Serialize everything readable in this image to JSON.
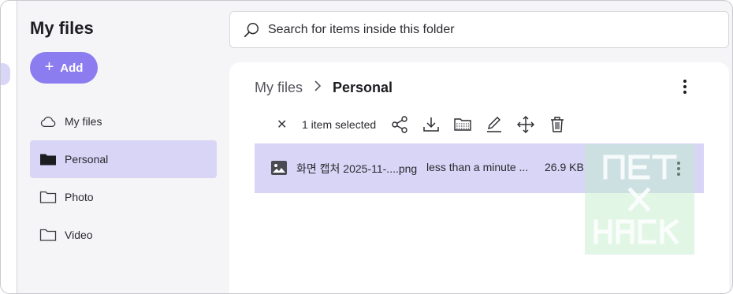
{
  "sidebar": {
    "title": "My files",
    "add_label": "Add",
    "items": [
      {
        "label": "My files",
        "icon": "cloud-icon"
      },
      {
        "label": "Personal",
        "icon": "folder-filled-icon",
        "active": true
      },
      {
        "label": "Photo",
        "icon": "folder-icon"
      },
      {
        "label": "Video",
        "icon": "folder-icon"
      }
    ]
  },
  "search": {
    "placeholder": "Search for items inside this folder"
  },
  "breadcrumb": {
    "root": "My files",
    "separator": "›",
    "current": "Personal"
  },
  "toolbar": {
    "selected_label": "1 item selected",
    "icons": [
      "share-icon",
      "download-icon",
      "folder-move-icon",
      "rename-pencil-icon",
      "move-arrows-icon",
      "trash-icon"
    ]
  },
  "files": [
    {
      "name": "화면 캡처 2025-11-....png",
      "modified": "less than a minute ...",
      "size": "26.9 KB",
      "icon": "image-file-icon",
      "selected": true
    }
  ],
  "colors": {
    "accent": "#8b7cf0",
    "selection": "#d8d5f6",
    "background": "#f5f5f7"
  }
}
